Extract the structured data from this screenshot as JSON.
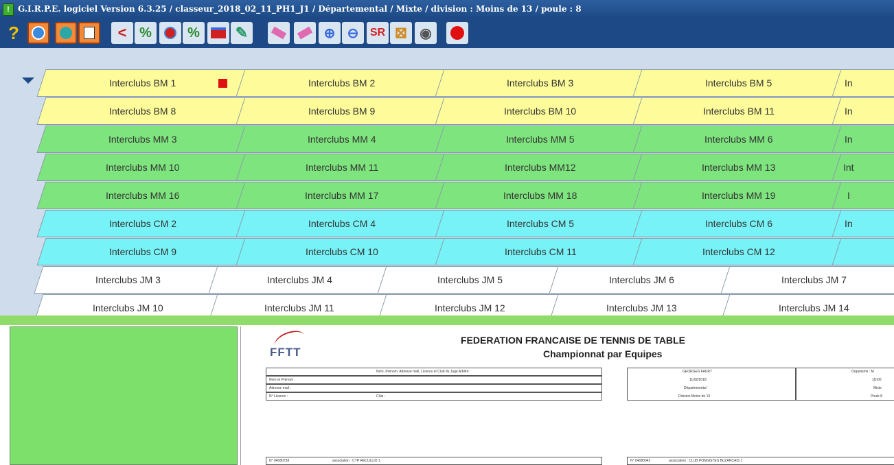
{
  "window": {
    "title": "G.I.R.P.E.  logiciel Version 6.3.25  /  classeur_2018_02_11_PH1_J1  /  Départemental  /  Mixte  /  division : Moins de 13  / poule : 8"
  },
  "toolbar": {
    "buttons": [
      {
        "icon": "help-icon"
      },
      {
        "icon": "medal-icon"
      },
      {
        "icon": "globe-icon"
      },
      {
        "icon": "document-icon"
      },
      {
        "icon": "share-icon"
      },
      {
        "icon": "link-icon"
      },
      {
        "icon": "web-icon"
      },
      {
        "icon": "link-settings-icon"
      },
      {
        "icon": "printer-icon"
      },
      {
        "icon": "pen-icon"
      },
      {
        "icon": "eraser-icon"
      },
      {
        "icon": "brush-icon"
      },
      {
        "icon": "zoom-in-icon"
      },
      {
        "icon": "zoom-out-icon"
      },
      {
        "icon": "sr-icon"
      },
      {
        "icon": "grid-icon"
      },
      {
        "icon": "camera-icon"
      },
      {
        "icon": "power-icon"
      }
    ],
    "sr_label": "SR"
  },
  "tabs": {
    "rows": [
      {
        "color": "yellow",
        "items": [
          "Interclubs BM 1",
          "Interclubs BM 2",
          "Interclubs BM 3",
          "Interclubs BM 5",
          "In"
        ]
      },
      {
        "color": "yellow",
        "items": [
          "Interclubs BM 8",
          "Interclubs BM 9",
          "Interclubs BM 10",
          "Interclubs BM 11",
          "In"
        ]
      },
      {
        "color": "green",
        "items": [
          "Interclubs MM 3",
          "Interclubs MM 4",
          "Interclubs MM 5",
          "Interclubs MM 6",
          "In"
        ]
      },
      {
        "color": "green",
        "items": [
          "Interclubs MM 10",
          "Interclubs MM 11",
          "Interclubs MM12",
          "Interclubs MM 13",
          "Int"
        ]
      },
      {
        "color": "green",
        "items": [
          "Interclubs MM 16",
          "Interclubs MM 17",
          "Interclubs MM  18",
          "Interclubs MM 19",
          "I"
        ]
      },
      {
        "color": "cyan",
        "items": [
          "Interclubs CM 2",
          "Interclubs CM 4",
          "Interclubs CM 5",
          "Interclubs CM 6",
          "In"
        ]
      },
      {
        "color": "cyan",
        "items": [
          "Interclubs CM 9",
          "Interclubs CM 10",
          "Interclubs CM 11",
          "Interclubs CM 12",
          ""
        ]
      },
      {
        "color": "white",
        "items": [
          "Interclubs JM 3",
          "Interclubs JM 4",
          "Interclubs JM 5",
          "Interclubs JM 6",
          "Interclubs JM 7"
        ]
      },
      {
        "color": "white",
        "items": [
          "Interclubs JM 10",
          "Interclubs JM 11",
          "Interclubs JM 12",
          "Interclubs JM 13",
          "Interclubs JM 14"
        ]
      }
    ]
  },
  "document": {
    "logo": "FFTT",
    "title": "FEDERATION FRANCAISE DE TENNIS DE TABLE",
    "subtitle": "Championnat par Equipes",
    "left_header": "Nom, Prénom, Adresse mail, Licence et Club du Juge Arbitre :",
    "left_rows": [
      "Nom et Prénom :",
      "Adresse mail :",
      "N° Licence :"
    ],
    "club_label": "Club :",
    "right_cells": [
      "GEORGES FAURT",
      "11/02/2018",
      "Départemental",
      "Division  Moins de 13"
    ],
    "right_cells2": [
      "Organisme : M",
      "11h00",
      "Mixte",
      "Poule 8"
    ],
    "bottom_left": [
      "N° 04080738",
      "association : CTP RECULLIO 1"
    ],
    "bottom_right": [
      "N° 04080042",
      "association : CLUB PONGISTES BUZANCAIS 1"
    ]
  }
}
